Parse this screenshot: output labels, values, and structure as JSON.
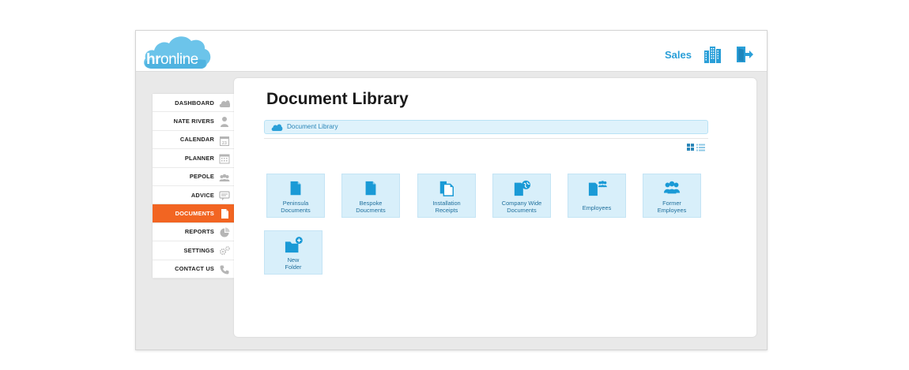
{
  "brand": {
    "logo_bold": "hr",
    "logo_light": "online"
  },
  "header": {
    "sales_label": "Sales"
  },
  "sidebar": {
    "items": [
      {
        "label": "DASHBOARD",
        "icon": "cloud-icon",
        "active": false
      },
      {
        "label": "NATE RIVERS",
        "icon": "person-icon",
        "active": false
      },
      {
        "label": "CALENDAR",
        "icon": "calendar-icon",
        "active": false
      },
      {
        "label": "PLANNER",
        "icon": "planner-icon",
        "active": false
      },
      {
        "label": "PEPOLE",
        "icon": "people-icon",
        "active": false
      },
      {
        "label": "ADVICE",
        "icon": "chat-icon",
        "active": false
      },
      {
        "label": "DOCUMENTS",
        "icon": "document-icon",
        "active": true
      },
      {
        "label": "REPORTS",
        "icon": "pie-chart-icon",
        "active": false
      },
      {
        "label": "SETTINGS",
        "icon": "gears-icon",
        "active": false
      },
      {
        "label": "CONTACT US",
        "icon": "phone-icon",
        "active": false
      }
    ]
  },
  "main": {
    "title": "Document Library",
    "breadcrumb": "Document Library",
    "tiles": [
      {
        "line1": "Peninsula",
        "line2": "Documents",
        "icon": "document-icon"
      },
      {
        "line1": "Bespoke",
        "line2": "Doucments",
        "icon": "document-icon"
      },
      {
        "line1": "Installation",
        "line2": "Receipts",
        "icon": "documents-stack-icon"
      },
      {
        "line1": "Company Wide",
        "line2": "Documents",
        "icon": "document-globe-icon"
      },
      {
        "line1": "Employees",
        "line2": "",
        "icon": "document-people-icon"
      },
      {
        "line1": "Former",
        "line2": "Employees",
        "icon": "people-icon"
      },
      {
        "line1": "New",
        "line2": "Folder",
        "icon": "folder-add-icon"
      }
    ]
  },
  "colors": {
    "accent": "#2a9fd8",
    "active_nav": "#f26522",
    "tile_bg": "#d8effa"
  }
}
